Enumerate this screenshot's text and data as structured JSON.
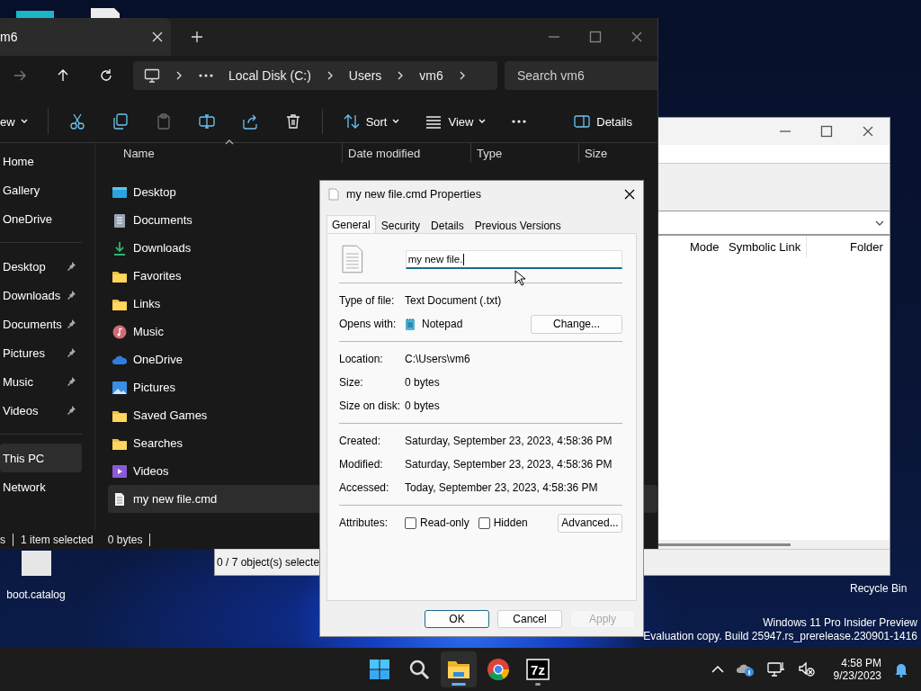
{
  "desktop": {
    "labeled_icons": [
      {
        "label": "boot.catalog"
      }
    ],
    "recycle_bin": {
      "label": "Recycle Bin"
    },
    "edition_notice": [
      "Windows 11 Pro Insider Preview",
      "Evaluation copy. Build 25947.rs_prerelease.230901-1416"
    ]
  },
  "explorer": {
    "tab_title": "m6",
    "address": [
      "Local Disk (C:)",
      "Users",
      "vm6"
    ],
    "search": {
      "placeholder": "Search vm6"
    },
    "commands": [
      {
        "kind": "new",
        "label": "ew",
        "disabled": false
      },
      {
        "kind": "cut",
        "disabled": false
      },
      {
        "kind": "copy",
        "disabled": false
      },
      {
        "kind": "paste",
        "disabled": true
      },
      {
        "kind": "rename",
        "disabled": false
      },
      {
        "kind": "share",
        "disabled": false
      },
      {
        "kind": "delete",
        "disabled": false
      },
      {
        "kind": "sort",
        "label": "Sort",
        "disabled": false
      },
      {
        "kind": "view",
        "label": "View",
        "disabled": false
      },
      {
        "kind": "more",
        "disabled": false
      },
      {
        "kind": "details",
        "label": "Details",
        "disabled": false
      }
    ],
    "sidebar": {
      "groups": [
        {
          "items": [
            {
              "label": "Home",
              "pinned": false,
              "selected": false
            },
            {
              "label": "Gallery",
              "pinned": false,
              "selected": false
            },
            {
              "label": "OneDrive",
              "pinned": false,
              "selected": false
            }
          ]
        },
        {
          "items": [
            {
              "label": "Desktop",
              "pinned": true,
              "selected": false
            },
            {
              "label": "Downloads",
              "pinned": true,
              "selected": false
            },
            {
              "label": "Documents",
              "pinned": true,
              "selected": false
            },
            {
              "label": "Pictures",
              "pinned": true,
              "selected": false
            },
            {
              "label": "Music",
              "pinned": true,
              "selected": false
            },
            {
              "label": "Videos",
              "pinned": true,
              "selected": false
            }
          ]
        },
        {
          "items": [
            {
              "label": "This PC",
              "pinned": false,
              "selected": true
            },
            {
              "label": "Network",
              "pinned": false,
              "selected": false
            }
          ]
        }
      ]
    },
    "columns": [
      "Name",
      "Date modified",
      "Type",
      "Size"
    ],
    "files": [
      {
        "name": "Desktop",
        "kind": "desktop",
        "selected": false
      },
      {
        "name": "Documents",
        "kind": "documents",
        "selected": false
      },
      {
        "name": "Downloads",
        "kind": "downloads",
        "selected": false
      },
      {
        "name": "Favorites",
        "kind": "folder",
        "selected": false
      },
      {
        "name": "Links",
        "kind": "folder",
        "selected": false
      },
      {
        "name": "Music",
        "kind": "music",
        "selected": false
      },
      {
        "name": "OneDrive",
        "kind": "onedrive",
        "selected": false
      },
      {
        "name": "Pictures",
        "kind": "pictures",
        "selected": false
      },
      {
        "name": "Saved Games",
        "kind": "folder",
        "selected": false
      },
      {
        "name": "Searches",
        "kind": "folder",
        "selected": false
      },
      {
        "name": "Videos",
        "kind": "videos",
        "selected": false
      },
      {
        "name": "my new file.cmd",
        "kind": "file",
        "selected": true
      }
    ],
    "status_bar": {
      "count": "s",
      "selection": "1 item selected",
      "size": "0 bytes"
    }
  },
  "back_window": {
    "columns": [
      "Mode",
      "Symbolic Link",
      "Folder"
    ],
    "status": "0 / 7 object(s) selecte"
  },
  "dialog": {
    "title": "my new file.cmd Properties",
    "tabs": [
      {
        "label": "General",
        "selected": true
      },
      {
        "label": "Security",
        "selected": false
      },
      {
        "label": "Details",
        "selected": false
      },
      {
        "label": "Previous Versions",
        "selected": false
      }
    ],
    "name_field": {
      "value": "my new file.",
      "focused": true
    },
    "sections": [
      [
        {
          "label": "Type of file:",
          "value": "Text Document (.txt)"
        },
        {
          "label": "Opens with:",
          "value": "Notepad",
          "kind": "app",
          "button": "Change..."
        }
      ],
      [
        {
          "label": "Location:",
          "value": "C:\\Users\\vm6"
        },
        {
          "label": "Size:",
          "value": "0 bytes"
        },
        {
          "label": "Size on disk:",
          "value": "0 bytes"
        }
      ],
      [
        {
          "label": "Created:",
          "value": "Saturday, September 23, 2023, 4:58:36 PM"
        },
        {
          "label": "Modified:",
          "value": "Saturday, September 23, 2023, 4:58:36 PM"
        },
        {
          "label": "Accessed:",
          "value": "Today, September 23, 2023, 4:58:36 PM"
        }
      ]
    ],
    "attributes": {
      "label": "Attributes:",
      "checkboxes": [
        {
          "label": "Read-only",
          "checked": false
        },
        {
          "label": "Hidden",
          "checked": false
        }
      ],
      "button": "Advanced..."
    },
    "buttons": [
      {
        "label": "OK",
        "default": true,
        "disabled": false
      },
      {
        "label": "Cancel",
        "default": false,
        "disabled": false
      },
      {
        "label": "Apply",
        "default": false,
        "disabled": true
      }
    ]
  },
  "taskbar": {
    "apps": [
      {
        "kind": "start",
        "active": false,
        "running": false
      },
      {
        "kind": "search",
        "active": false,
        "running": false
      },
      {
        "kind": "explorer",
        "active": true,
        "running": true
      },
      {
        "kind": "browser",
        "active": false,
        "running": false
      },
      {
        "kind": "sevenzip",
        "label": "7z",
        "active": false,
        "running": true
      }
    ],
    "time": "4:58 PM",
    "date": "9/23/2023"
  }
}
